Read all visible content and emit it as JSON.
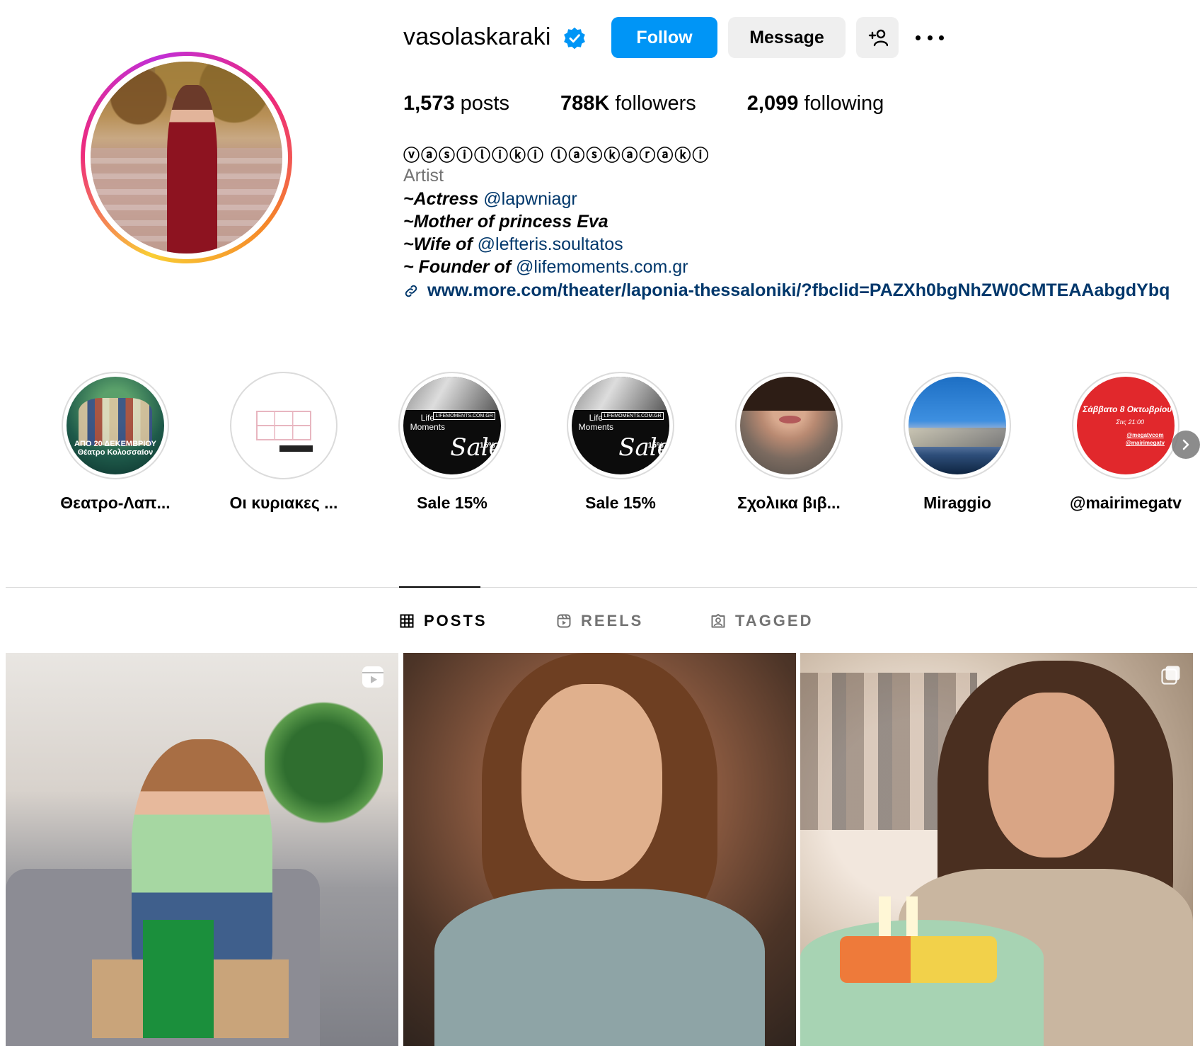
{
  "profile": {
    "username": "vasolaskaraki",
    "verified": true,
    "follow_label": "Follow",
    "message_label": "Message",
    "stats": {
      "posts_count": "1,573",
      "posts_label": "posts",
      "followers_count": "788K",
      "followers_label": "followers",
      "following_count": "2,099",
      "following_label": "following"
    },
    "full_name": "ⓥⓐⓢⓘⓛⓘⓚⓘ ⓛⓐⓢⓚⓐⓡⓐⓚⓘ",
    "category": "Artist",
    "bio": {
      "line1_text": "~Actress",
      "line1_mention": "@lapwniagr",
      "line2_text": "~Mother of princess Eva",
      "line3_text": "~Wife of",
      "line3_mention": "@lefteris.soultatos",
      "line4_text": "~ Founder of",
      "line4_mention": "@lifemoments.com.gr"
    },
    "website": "www.more.com/theater/laponia-thessaloniki/?fbclid=PAZXh0bgNhZW0CMTEAAabgdYbq"
  },
  "highlights": [
    {
      "label": "Θεατρο-Λαπ...",
      "image_text": "ΑΠΟ 20 ΔΕΚΕΜΒΡΙΟΥ\nΘέατρο Κολοσσαίον"
    },
    {
      "label": "Οι κυριακες ..."
    },
    {
      "label": "Sale 15%",
      "image_text_1": "Life\nMoments",
      "image_text_2": "LIFEMOMENTS.COM.GR",
      "image_sale": "Sale",
      "image_pct": "15%"
    },
    {
      "label": "Sale 15%",
      "image_text_1": "Life\nMoments",
      "image_text_2": "LIFEMOMENTS.COM.GR",
      "image_sale": "Sale",
      "image_pct": "15%"
    },
    {
      "label": "Σχολικα βιβ..."
    },
    {
      "label": "Miraggio"
    },
    {
      "label": "@mairimegatv",
      "image_line1": "Σάββατο 8 Οκτωβρίου",
      "image_line2": "Στις 21:00",
      "image_line3": "@megatvcom\n@mairimegatv"
    }
  ],
  "tabs": {
    "posts": "POSTS",
    "reels": "REELS",
    "tagged": "TAGGED",
    "active": "posts"
  },
  "colors": {
    "follow_button": "#0095f6",
    "link": "#00376b",
    "verified_badge": "#0095f6",
    "muted_text": "#737373"
  }
}
